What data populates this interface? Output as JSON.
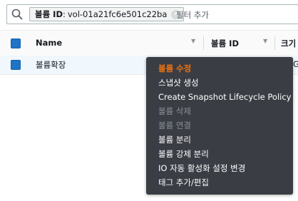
{
  "search": {
    "chip_key": "볼륨 ID",
    "chip_separator": ":",
    "chip_value": "vol-01a21fc6e501c22ba",
    "chip_close": "×",
    "placeholder": "필터 추가"
  },
  "table": {
    "columns": [
      {
        "label": "Name"
      },
      {
        "label": "볼륨 ID"
      },
      {
        "label": "크기"
      }
    ],
    "sort_glyph": "▼",
    "rows": [
      {
        "name": "볼륨확장",
        "truncated": "G"
      }
    ]
  },
  "context_menu": {
    "items": [
      {
        "label": "볼륨 수정",
        "state": "highlighted"
      },
      {
        "label": "스냅샷 생성",
        "state": "enabled"
      },
      {
        "label": "Create Snapshot Lifecycle Policy",
        "state": "enabled"
      },
      {
        "label": "볼륨 삭제",
        "state": "disabled"
      },
      {
        "label": "볼륨 연결",
        "state": "disabled"
      },
      {
        "label": "볼륨 분리",
        "state": "enabled"
      },
      {
        "label": "볼륨 강제 분리",
        "state": "enabled"
      },
      {
        "label": "IO 자동 활성화 설정 변경",
        "state": "enabled"
      },
      {
        "label": "태그 추가/편집",
        "state": "enabled"
      }
    ]
  },
  "colors": {
    "checkbox": "#1e74c6",
    "menu_bg": "#3a3d44",
    "menu_highlight": "#ec7211",
    "selected_row_bg": "#f0f7fd"
  },
  "icons": {
    "search": "search-icon",
    "chip_close": "close-icon",
    "sort": "caret-down-icon"
  }
}
